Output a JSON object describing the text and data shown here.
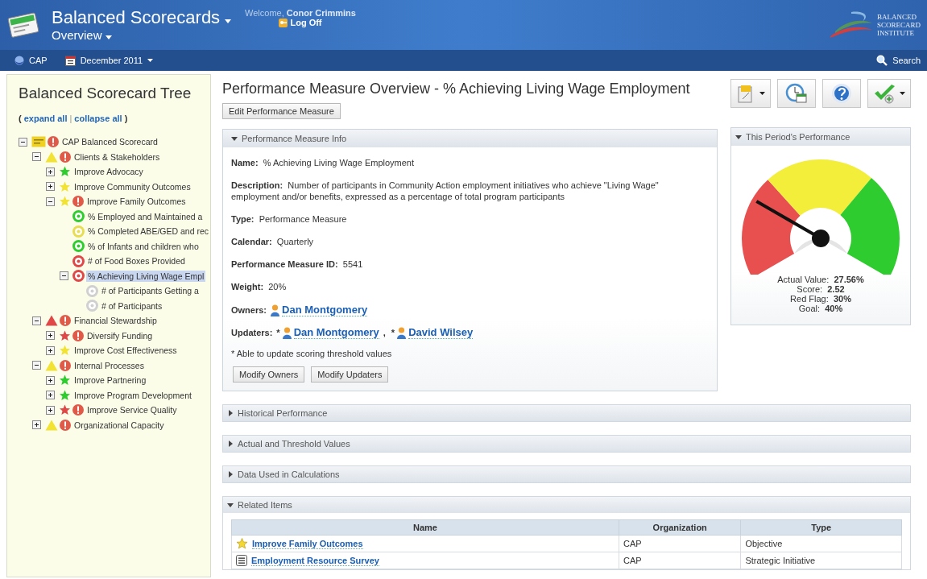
{
  "header": {
    "app_title": "Balanced Scorecards",
    "view": "Overview",
    "welcome": "Welcome,",
    "user": "Conor Crimmins",
    "logoff": "Log Off",
    "logo_lines": [
      "BALANCED",
      "SCORECARD",
      "INSTITUTE"
    ]
  },
  "subbar": {
    "organization": "CAP",
    "period": "December 2011",
    "search": "Search"
  },
  "tree": {
    "title": "Balanced Scorecard Tree",
    "open_paren": "(",
    "expand_all": "expand all",
    "separator": "|",
    "collapse_all": "collapse all",
    "close_paren": ")",
    "items": [
      {
        "label": "CAP Balanced Scorecard",
        "kind": "scorecard",
        "color": "#f0d020",
        "alert": true,
        "expanded": true,
        "selected": false,
        "children": [
          {
            "label": "Clients & Stakeholders",
            "kind": "triangle",
            "color": "#f2e233",
            "alert": true,
            "expanded": true,
            "selected": false,
            "children": [
              {
                "label": "Improve Advocacy",
                "kind": "star",
                "color": "#2fcc2f",
                "alert": false,
                "expanded": false,
                "selected": false
              },
              {
                "label": "Improve Community Outcomes",
                "kind": "star",
                "color": "#f2e233",
                "alert": false,
                "expanded": false,
                "selected": false
              },
              {
                "label": "Improve Family Outcomes",
                "kind": "star",
                "color": "#f2e233",
                "alert": true,
                "expanded": true,
                "selected": false,
                "children": [
                  {
                    "label": "% Employed and Maintained a",
                    "kind": "target",
                    "color": "#2fcc2f",
                    "alert": false,
                    "selected": false
                  },
                  {
                    "label": "% Completed ABE/GED and rec",
                    "kind": "target",
                    "color": "#e8dc50",
                    "alert": false,
                    "selected": false
                  },
                  {
                    "label": "% of Infants and children who",
                    "kind": "target",
                    "color": "#2fcc2f",
                    "alert": false,
                    "selected": false
                  },
                  {
                    "label": "# of Food Boxes Provided",
                    "kind": "target",
                    "color": "#e04848",
                    "alert": false,
                    "selected": false
                  },
                  {
                    "label": "% Achieving Living Wage Empl",
                    "kind": "target",
                    "color": "#e04848",
                    "alert": false,
                    "expanded": true,
                    "selected": true,
                    "children": [
                      {
                        "label": "# of Participants Getting a",
                        "kind": "target",
                        "color": "#d0d0d0",
                        "alert": false,
                        "selected": false
                      },
                      {
                        "label": "# of Participants",
                        "kind": "target",
                        "color": "#d0d0d0",
                        "alert": false,
                        "selected": false
                      }
                    ]
                  }
                ]
              }
            ]
          },
          {
            "label": "Financial Stewardship",
            "kind": "triangle",
            "color": "#e04848",
            "alert": true,
            "expanded": true,
            "selected": false,
            "children": [
              {
                "label": "Diversify Funding",
                "kind": "star",
                "color": "#e04848",
                "alert": true,
                "expanded": false,
                "selected": false
              },
              {
                "label": "Improve Cost Effectiveness",
                "kind": "star",
                "color": "#f2e233",
                "alert": false,
                "expanded": false,
                "selected": false
              }
            ]
          },
          {
            "label": "Internal Processes",
            "kind": "triangle",
            "color": "#f2e233",
            "alert": true,
            "expanded": true,
            "selected": false,
            "children": [
              {
                "label": "Improve Partnering",
                "kind": "star",
                "color": "#2fcc2f",
                "alert": false,
                "expanded": false,
                "selected": false
              },
              {
                "label": "Improve Program Development",
                "kind": "star",
                "color": "#2fcc2f",
                "alert": false,
                "expanded": false,
                "selected": false
              },
              {
                "label": "Improve Service Quality",
                "kind": "star",
                "color": "#e04848",
                "alert": true,
                "expanded": false,
                "selected": false
              }
            ]
          },
          {
            "label": "Organizational Capacity",
            "kind": "triangle",
            "color": "#f2e233",
            "alert": true,
            "expanded": false,
            "selected": false
          }
        ]
      }
    ]
  },
  "page": {
    "title": "Performance Measure Overview - % Achieving Living Wage Employment",
    "edit_button": "Edit Performance Measure",
    "toolbar": [
      {
        "kind": "document",
        "dropdown": true
      },
      {
        "kind": "clock",
        "dropdown": false
      },
      {
        "kind": "help",
        "dropdown": false
      },
      {
        "kind": "check",
        "dropdown": true
      }
    ]
  },
  "info": {
    "title": "Performance Measure Info",
    "expanded": true,
    "fields": [
      {
        "kind": "text",
        "label": "Name:",
        "value": "% Achieving Living Wage Employment"
      },
      {
        "kind": "text",
        "label": "Description:",
        "value": "Number of participants in Community Action employment initiatives who achieve \"Living Wage\" employment and/or benefits, expressed as a percentage of total program participants"
      },
      {
        "kind": "text",
        "label": "Type:",
        "value": "Performance Measure"
      },
      {
        "kind": "text",
        "label": "Calendar:",
        "value": "Quarterly"
      },
      {
        "kind": "text",
        "label": "Performance Measure ID:",
        "value": "5541"
      },
      {
        "kind": "text",
        "label": "Weight:",
        "value": "20%"
      },
      {
        "kind": "people",
        "label": "Owners:",
        "people": [
          {
            "name": "Dan Montgomery"
          }
        ]
      },
      {
        "kind": "people",
        "label": "Updaters:",
        "separator": ",",
        "people": [
          {
            "mark": "*",
            "name": "Dan Montgomery"
          },
          {
            "mark": "*",
            "name": "David Wilsey"
          }
        ]
      }
    ],
    "footnote": "* Able to update scoring threshold values",
    "buttons": [
      "Modify Owners",
      "Modify Updaters"
    ]
  },
  "performance": {
    "title": "This Period's Performance",
    "expanded": true,
    "stats": [
      {
        "label": "Actual Value:",
        "value": "27.56%"
      },
      {
        "label": "Score:",
        "value": "2.52"
      },
      {
        "label": "Red Flag:",
        "value": "30%"
      },
      {
        "label": "Goal:",
        "value": "40%"
      }
    ]
  },
  "sections": [
    {
      "title": "Historical Performance",
      "expanded": false
    },
    {
      "title": "Actual and Threshold Values",
      "expanded": false
    },
    {
      "title": "Data Used in Calculations",
      "expanded": false
    }
  ],
  "related": {
    "title": "Related Items",
    "expanded": true,
    "columns": [
      "Name",
      "Organization",
      "Type"
    ],
    "rows": [
      {
        "kind": "star",
        "name": "Improve Family Outcomes",
        "organization": "CAP",
        "type": "Objective"
      },
      {
        "kind": "list",
        "name": "Employment Resource Survey",
        "organization": "CAP",
        "type": "Strategic Initiative"
      }
    ]
  }
}
